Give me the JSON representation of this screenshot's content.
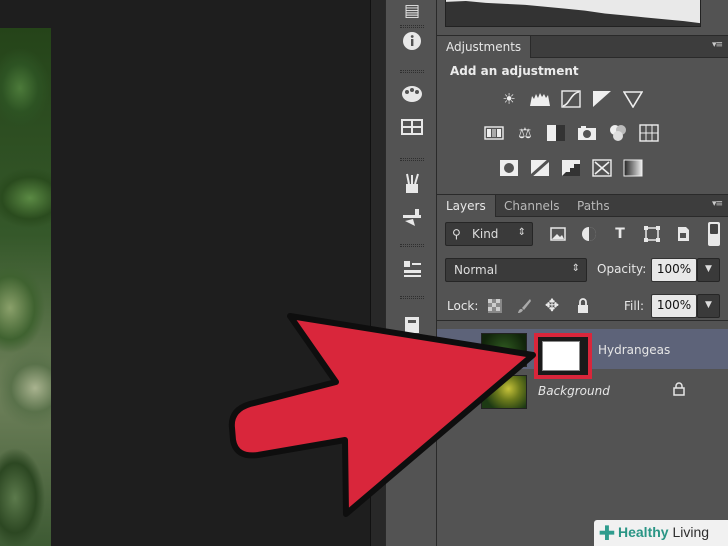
{
  "adjustments_panel": {
    "tab_label": "Adjustments",
    "title": "Add an adjustment",
    "row1_icons": [
      "brightness-icon",
      "levels-icon",
      "curves-icon",
      "exposure-icon",
      "vibrance-icon"
    ],
    "row2_icons": [
      "hue-saturation-icon",
      "color-balance-icon",
      "black-white-icon",
      "photo-filter-icon",
      "channel-mixer-icon",
      "color-lookup-icon"
    ],
    "row3_icons": [
      "invert-icon",
      "posterize-icon",
      "threshold-icon",
      "selective-color-icon",
      "gradient-map-icon"
    ]
  },
  "layers_panel": {
    "tabs": [
      "Layers",
      "Channels",
      "Paths"
    ],
    "filter_kind": "Kind",
    "blend_mode": "Normal",
    "opacity_label": "Opacity:",
    "opacity_value": "100%",
    "lock_label": "Lock:",
    "fill_label": "Fill:",
    "fill_value": "100%",
    "layers": [
      {
        "name": "Hydrangeas",
        "selected": true,
        "has_mask": true
      },
      {
        "name": "Background",
        "selected": false,
        "locked": true
      }
    ]
  },
  "watermark": {
    "prefix": "Healthy",
    "suffix": " Living"
  },
  "colors": {
    "panel_bg": "#535353",
    "tab_bar": "#3d3d3d",
    "selected_layer": "#5d6379",
    "highlight_red": "#d9263b",
    "watermark_green": "#2a9585"
  }
}
